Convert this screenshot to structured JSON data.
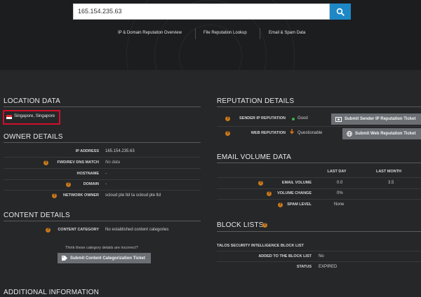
{
  "search": {
    "value": "165.154.235.63",
    "button_icon": "search-icon"
  },
  "nav": {
    "items": [
      "IP & Domain Reputation Overview",
      "File Reputation Lookup",
      "Email & Spam Data"
    ]
  },
  "location": {
    "title": "LOCATION DATA",
    "value": "Singapore, Singapore",
    "flag_icon": "singapore-flag-icon"
  },
  "owner": {
    "title": "OWNER DETAILS",
    "rows": [
      {
        "label": "IP ADDRESS",
        "value": "165.154.235.63",
        "help": false,
        "italic": false
      },
      {
        "label": "FWD/REV DNS MATCH",
        "value": "No data",
        "help": true,
        "italic": true
      },
      {
        "label": "HOSTNAME",
        "value": "-",
        "help": false,
        "italic": false
      },
      {
        "label": "DOMAIN",
        "value": "-",
        "help": true,
        "italic": false
      },
      {
        "label": "NETWORK OWNER",
        "value": "scloud pte ltd ta scloud pte ltd",
        "help": true,
        "italic": false
      }
    ]
  },
  "content": {
    "title": "CONTENT DETAILS",
    "category_label": "CONTENT CATEGORY",
    "category_value": "No established content categories",
    "incorrect_prompt": "Think these category details are incorrect?",
    "submit_label": "Submit Content Categorization Ticket"
  },
  "additional": {
    "title": "ADDITIONAL INFORMATION"
  },
  "reputation": {
    "title": "REPUTATION DETAILS",
    "sender_label": "SENDER IP REPUTATION",
    "sender_value": "Good",
    "sender_color": "#3bb34a",
    "sender_button": "Submit Sender IP Reputation Ticket",
    "web_label": "WEB REPUTATION",
    "web_value": "Questionable",
    "web_color": "#e07b1a",
    "web_button": "Submit Web Reputation Ticket"
  },
  "email_volume": {
    "title": "EMAIL VOLUME DATA",
    "col_headers": [
      "LAST DAY",
      "LAST MONTH"
    ],
    "rows": [
      {
        "label": "EMAIL VOLUME",
        "day": "0.0",
        "month": "3.5"
      },
      {
        "label": "VOLUME CHANGE",
        "day": "0%",
        "month": ""
      },
      {
        "label": "SPAM LEVEL",
        "day": "None",
        "month": ""
      }
    ]
  },
  "block_lists": {
    "title": "BLOCK LISTS",
    "list_name": "TALOS SECURITY INTELLIGENCE BLOCK LIST",
    "added_label": "ADDED TO THE BLOCK LIST",
    "added_value": "No",
    "status_label": "STATUS",
    "status_value": "EXPIRED"
  }
}
